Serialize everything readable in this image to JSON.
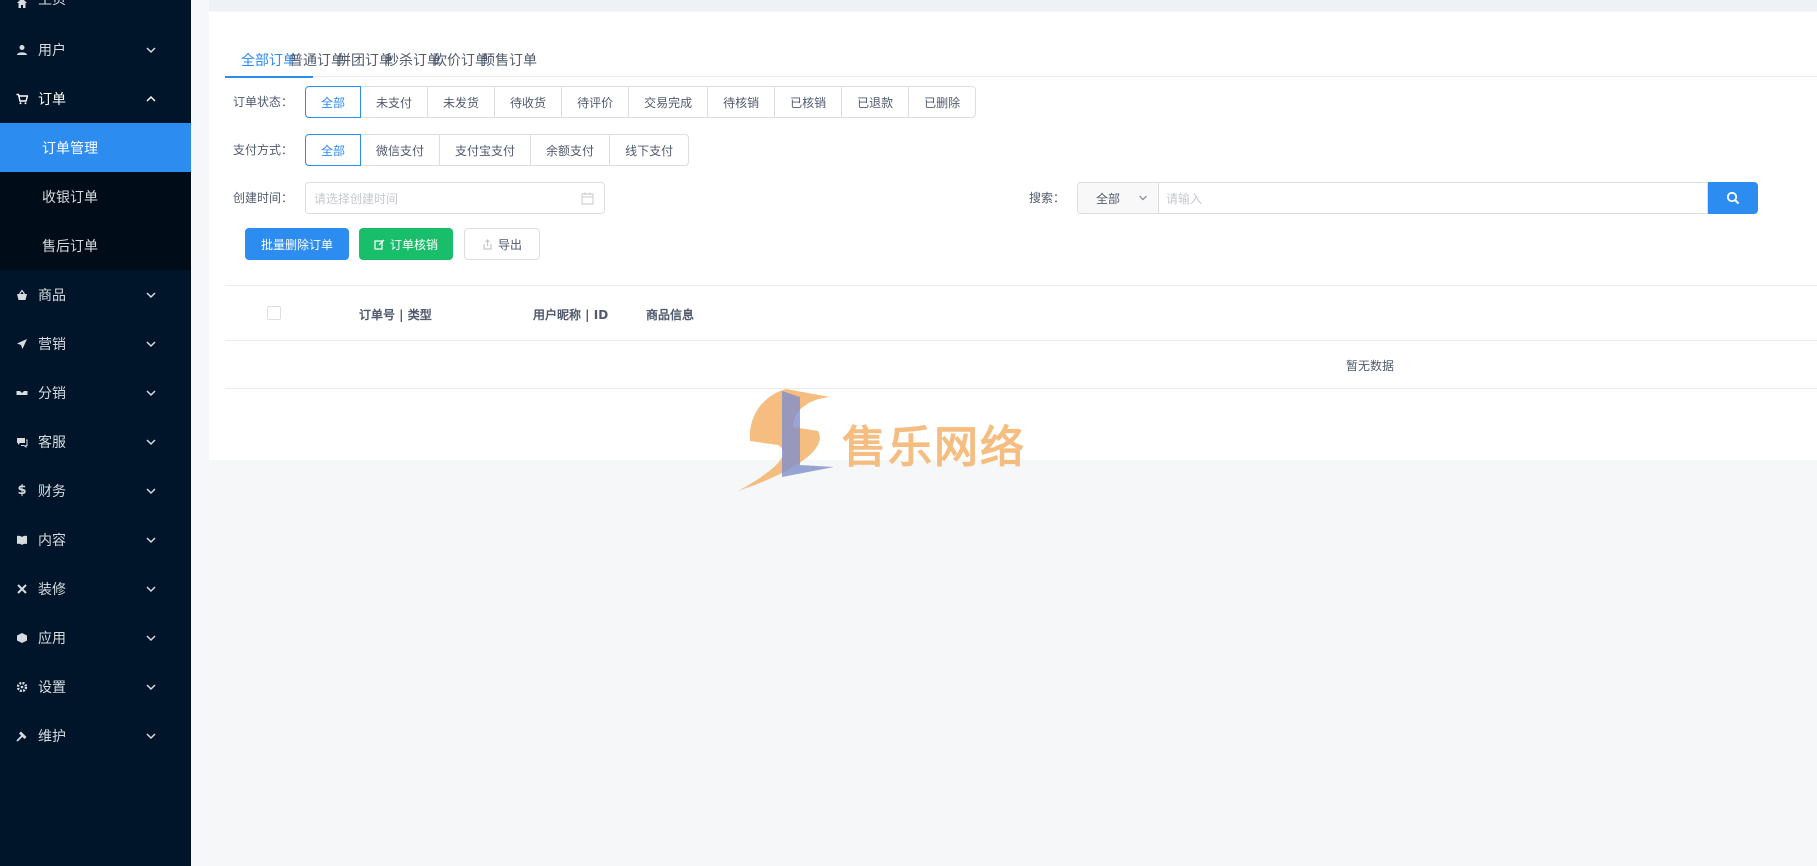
{
  "sidebar": {
    "items": [
      {
        "label": "主页",
        "icon": "home-icon"
      },
      {
        "label": "用户",
        "icon": "user-icon"
      },
      {
        "label": "订单",
        "icon": "cart-icon"
      },
      {
        "label": "商品",
        "icon": "basket-icon"
      },
      {
        "label": "营销",
        "icon": "send-icon"
      },
      {
        "label": "分销",
        "icon": "handshake-icon"
      },
      {
        "label": "客服",
        "icon": "chat-icon"
      },
      {
        "label": "财务",
        "icon": "dollar-icon"
      },
      {
        "label": "内容",
        "icon": "book-icon"
      },
      {
        "label": "装修",
        "icon": "tools-icon"
      },
      {
        "label": "应用",
        "icon": "cube-icon"
      },
      {
        "label": "设置",
        "icon": "gear-icon"
      },
      {
        "label": "维护",
        "icon": "hammer-icon"
      }
    ],
    "order_sub": [
      "订单管理",
      "收银订单",
      "售后订单"
    ]
  },
  "tabs": [
    "全部订单",
    "普通订单",
    "拼团订单",
    "秒杀订单",
    "砍价订单",
    "预售订单"
  ],
  "filters": {
    "status_label": "订单状态：",
    "status_options": [
      "全部",
      "未支付",
      "未发货",
      "待收货",
      "待评价",
      "交易完成",
      "待核销",
      "已核销",
      "已退款",
      "已删除"
    ],
    "pay_label": "支付方式：",
    "pay_options": [
      "全部",
      "微信支付",
      "支付宝支付",
      "余额支付",
      "线下支付"
    ],
    "time_label": "创建时间：",
    "time_placeholder": "请选择创建时间",
    "search_label": "搜索：",
    "search_select": "全部",
    "search_placeholder": "请输入"
  },
  "actions": {
    "batch_delete": "批量删除订单",
    "verify": "订单核销",
    "export": "导出"
  },
  "table": {
    "columns": [
      "订单号 | 类型",
      "用户昵称 | ID",
      "商品信息"
    ],
    "empty_text": "暂无数据"
  },
  "watermark": {
    "text": "售乐网络"
  },
  "colors": {
    "primary": "#2d8cf0",
    "success": "#19be6b",
    "sidebar": "#001529"
  }
}
